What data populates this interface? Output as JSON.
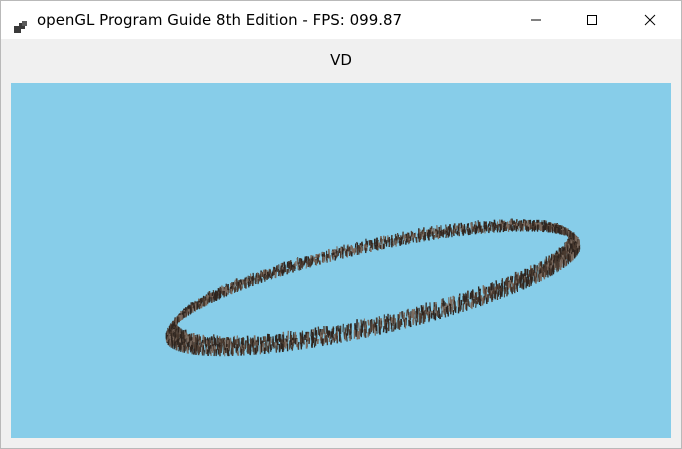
{
  "window": {
    "title": "openGL Program Guide 8th Edition - FPS: 099.87",
    "app_icon": "opengl-app-icon",
    "controls": {
      "minimize_icon": "minimize-icon",
      "maximize_icon": "maximize-icon",
      "close_icon": "close-icon"
    }
  },
  "content": {
    "label": "VD",
    "viewport": {
      "background_color": "#87cde9",
      "scene": "ring of instanced figures",
      "figure_color": "#4a3b30"
    }
  }
}
